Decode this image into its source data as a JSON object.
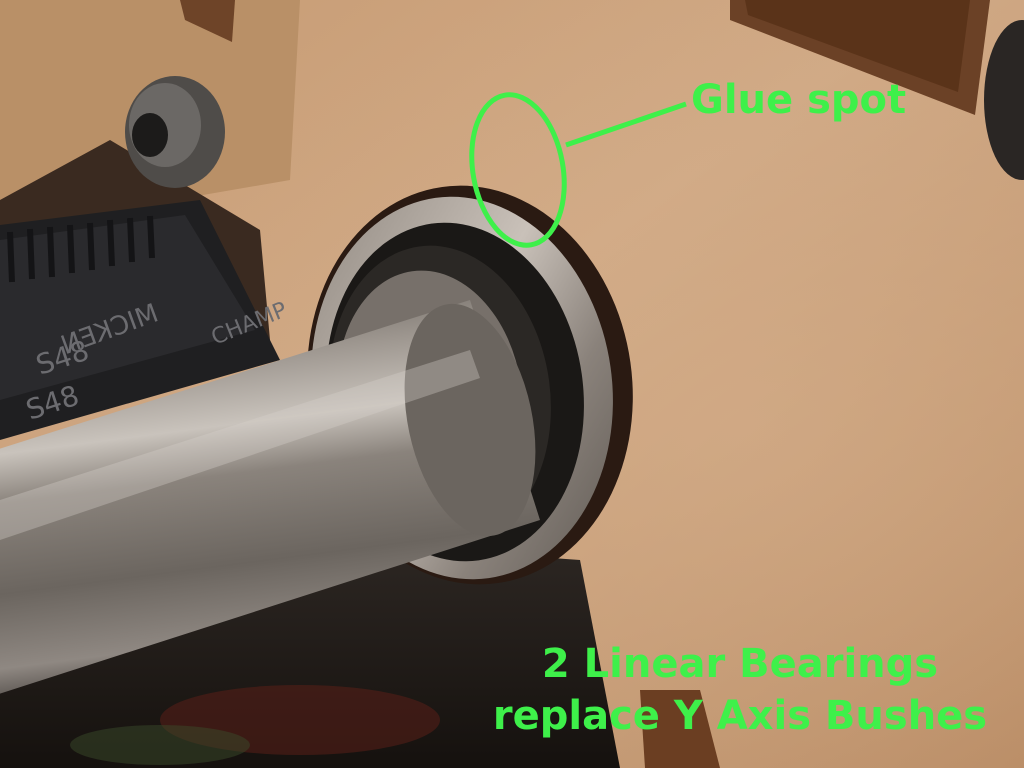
{
  "photo": {
    "subject": "linear-bearing-on-steel-rod-in-plywood-frame"
  },
  "annotations": {
    "glue_label": "Glue spot",
    "caption_line1": "2 Linear Bearings",
    "caption_line2": "replace Y Axis Bushes",
    "belt_text_1": "S48",
    "belt_text_2": "S48",
    "belt_text_3": "MICKEN",
    "belt_text_4": "CHAMP"
  },
  "colors": {
    "annotation": "#3ef04a",
    "plywood": "#c9a07a",
    "steel_rod": "#7c7670",
    "bearing_ring": "#a29a92",
    "belt": "#1c1c1e"
  }
}
